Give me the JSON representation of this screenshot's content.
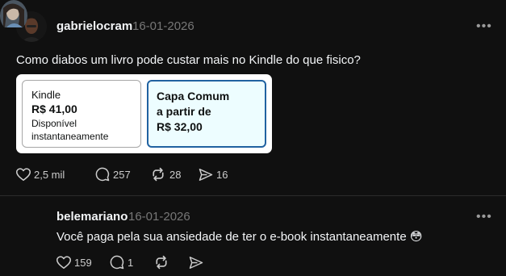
{
  "posts": [
    {
      "username": "gabrielocram",
      "timestamp": "16-01-2026",
      "text": "Como diabos um livro pode custar mais no Kindle do que fisico?",
      "image": {
        "kindle_format": "Kindle",
        "kindle_price": "R$ 41,00",
        "kindle_availability_1": "Disponível",
        "kindle_availability_2": "instantaneamente",
        "print_format": "Capa Comum",
        "print_from": "a partir de",
        "print_price": "R$ 32,00"
      },
      "likes": "2,5 mil",
      "replies": "257",
      "reposts": "28",
      "shares": "16"
    },
    {
      "username": "belemariano",
      "timestamp": "16-01-2026",
      "text": "Você paga pela sua ansiedade de ter o e-book instantaneamente 😳",
      "likes": "159",
      "replies": "1"
    }
  ],
  "icons": {
    "more": "more-horizontal-icon",
    "like": "heart-icon",
    "reply": "comment-icon",
    "repost": "repost-icon",
    "share": "send-icon"
  },
  "colors": {
    "background": "#101010",
    "text": "#f3f5f7",
    "muted": "#777777",
    "card_accent": "#2162a1"
  }
}
